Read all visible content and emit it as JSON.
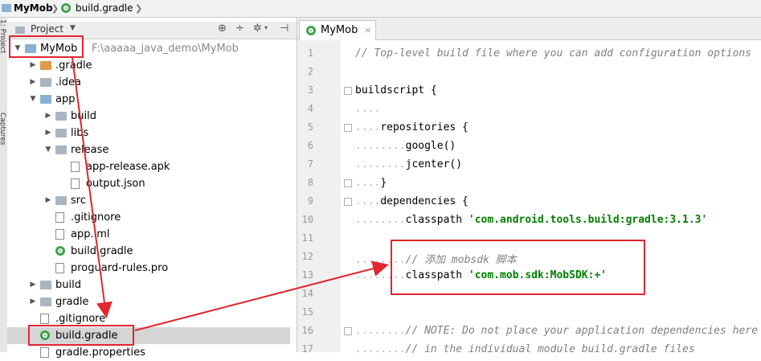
{
  "breadcrumb": {
    "root": "MyMob",
    "file": "build.gradle"
  },
  "tool_strip": {
    "project": "1: Project",
    "captures": "Captures"
  },
  "project_panel": {
    "view_label": "Project",
    "toolbar_icons": [
      "target-icon",
      "collapse-icon",
      "gear-icon",
      "hide-icon"
    ],
    "tree": [
      {
        "label": "MyMob",
        "path": "F:\\aaaaa_java_demo\\MyMob",
        "icon": "module-folder",
        "expanded": true,
        "depth": 0
      },
      {
        "label": ".gradle",
        "icon": "folder-orange",
        "expanded": false,
        "depth": 1
      },
      {
        "label": ".idea",
        "icon": "folder",
        "expanded": false,
        "depth": 1
      },
      {
        "label": "app",
        "icon": "folder-blue",
        "expanded": true,
        "depth": 1
      },
      {
        "label": "build",
        "icon": "folder",
        "expanded": false,
        "depth": 2
      },
      {
        "label": "libs",
        "icon": "folder",
        "expanded": false,
        "depth": 2
      },
      {
        "label": "release",
        "icon": "folder",
        "expanded": true,
        "depth": 2
      },
      {
        "label": "app-release.apk",
        "icon": "file",
        "depth": 3
      },
      {
        "label": "output.json",
        "icon": "file",
        "depth": 3
      },
      {
        "label": "src",
        "icon": "folder",
        "expanded": false,
        "depth": 2
      },
      {
        "label": ".gitignore",
        "icon": "file",
        "depth": 2
      },
      {
        "label": "app.iml",
        "icon": "file",
        "depth": 2
      },
      {
        "label": "build.gradle",
        "icon": "gradle",
        "depth": 2
      },
      {
        "label": "proguard-rules.pro",
        "icon": "file",
        "depth": 2
      },
      {
        "label": "build",
        "icon": "folder",
        "expanded": false,
        "depth": 1
      },
      {
        "label": "gradle",
        "icon": "folder",
        "expanded": false,
        "depth": 1
      },
      {
        "label": ".gitignore",
        "icon": "file",
        "depth": 1
      },
      {
        "label": "build.gradle",
        "icon": "gradle",
        "depth": 1,
        "selected": true
      },
      {
        "label": "gradle.properties",
        "icon": "file",
        "depth": 1
      }
    ]
  },
  "editor": {
    "tab_label": "MyMob",
    "lines": [
      {
        "n": "1",
        "parts": [
          {
            "t": "// Top-level build file where you can add configuration options",
            "c": "cmt"
          }
        ]
      },
      {
        "n": "2",
        "parts": []
      },
      {
        "n": "3",
        "parts": [
          {
            "t": "buildscript {",
            "c": "kw"
          }
        ]
      },
      {
        "n": "4",
        "parts": [
          {
            "t": "....",
            "c": "dots"
          }
        ]
      },
      {
        "n": "5",
        "parts": [
          {
            "t": "....",
            "c": "dots"
          },
          {
            "t": "repositories {",
            "c": "kw"
          }
        ]
      },
      {
        "n": "6",
        "parts": [
          {
            "t": "........",
            "c": "dots"
          },
          {
            "t": "google()",
            "c": "kw"
          }
        ]
      },
      {
        "n": "7",
        "parts": [
          {
            "t": "........",
            "c": "dots"
          },
          {
            "t": "jcenter()",
            "c": "kw"
          }
        ]
      },
      {
        "n": "8",
        "parts": [
          {
            "t": "....",
            "c": "dots"
          },
          {
            "t": "}",
            "c": "kw"
          }
        ]
      },
      {
        "n": "9",
        "parts": [
          {
            "t": "....",
            "c": "dots"
          },
          {
            "t": "dependencies {",
            "c": "kw"
          }
        ]
      },
      {
        "n": "10",
        "parts": [
          {
            "t": "........",
            "c": "dots"
          },
          {
            "t": "classpath ",
            "c": "kw"
          },
          {
            "t": "'com.android.tools.build:gradle:3.1.3'",
            "c": "str"
          }
        ]
      },
      {
        "n": "11",
        "parts": []
      },
      {
        "n": "12",
        "parts": [
          {
            "t": "........",
            "c": "dots"
          },
          {
            "t": "// 添加 mobsdk 脚本",
            "c": "cmt"
          }
        ]
      },
      {
        "n": "13",
        "parts": [
          {
            "t": "........",
            "c": "dots"
          },
          {
            "t": "classpath ",
            "c": "kw"
          },
          {
            "t": "'com.mob.sdk:MobSDK:+'",
            "c": "str"
          }
        ]
      },
      {
        "n": "14",
        "parts": []
      },
      {
        "n": "15",
        "parts": []
      },
      {
        "n": "16",
        "parts": [
          {
            "t": "........",
            "c": "dots"
          },
          {
            "t": "// NOTE: Do not place your application dependencies here",
            "c": "cmt"
          }
        ]
      },
      {
        "n": "17",
        "parts": [
          {
            "t": "........",
            "c": "dots"
          },
          {
            "t": "// in the individual module build.gradle files",
            "c": "cmt"
          }
        ]
      }
    ]
  },
  "colors": {
    "annotation_red": "#e0262f",
    "string_green": "#008000",
    "comment_gray": "#808080",
    "selection": "#d5d5d5"
  }
}
